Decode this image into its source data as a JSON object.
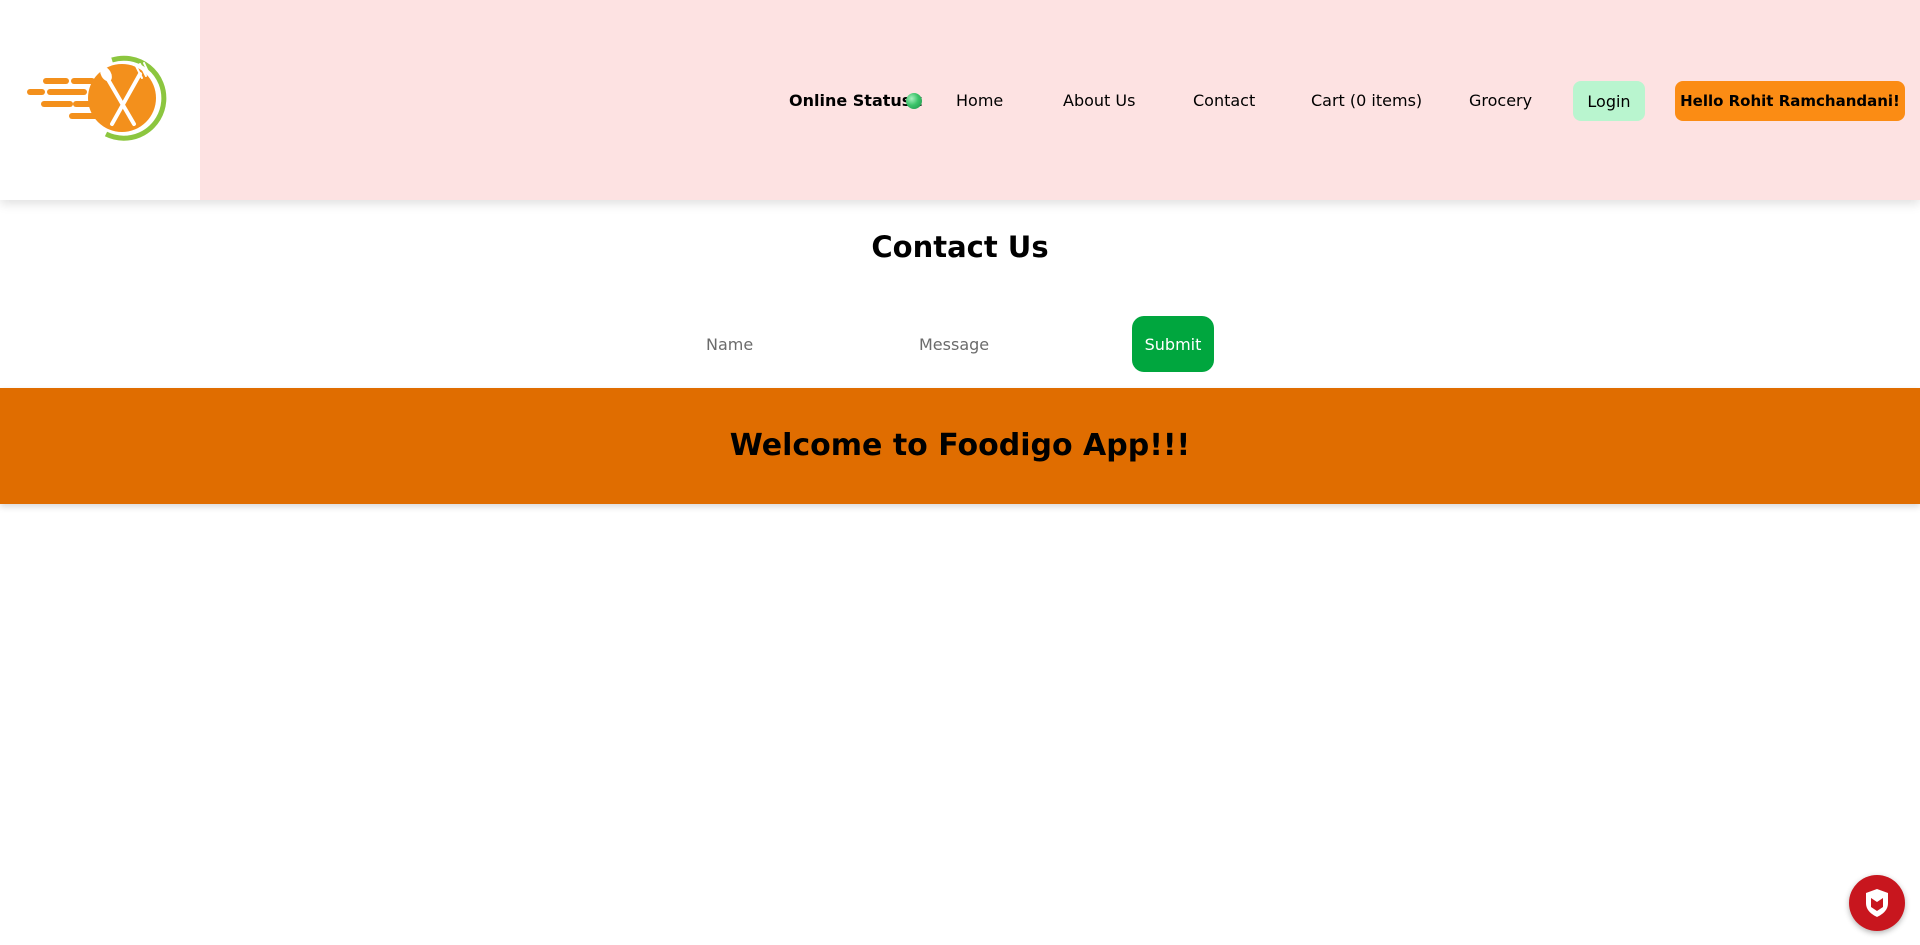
{
  "header": {
    "logo_icon": "food-delivery-logo-icon",
    "online_status_label": "Online Status :",
    "online_status_color": "#3cc46a",
    "nav": {
      "home": "Home",
      "about": "About Us",
      "contact": "Contact",
      "cart": "Cart (0 items)",
      "grocery": "Grocery"
    },
    "login_label": "Login",
    "greeting": "Hello Rohit Ramchandani!"
  },
  "contact": {
    "title": "Contact Us",
    "name_placeholder": "Name",
    "message_placeholder": "Message",
    "submit_label": "Submit"
  },
  "banner": {
    "title": "Welcome to Foodigo App!!!"
  },
  "extension_badge": {
    "icon": "mcafee-shield-icon"
  },
  "colors": {
    "header_bg": "#fde2e2",
    "banner_bg": "#e06d00",
    "submit_bg": "#00a63e",
    "login_bg": "#b9f5cf",
    "greeting_bg": "#fb8c14"
  }
}
